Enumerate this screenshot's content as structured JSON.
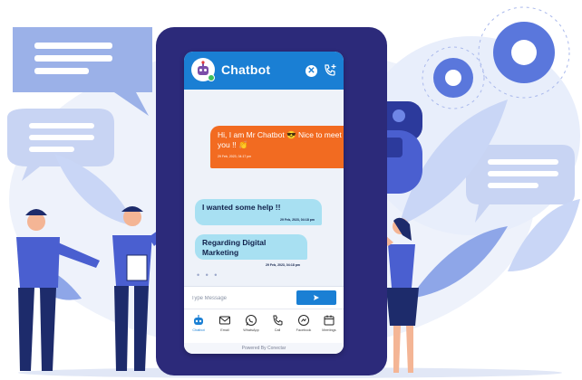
{
  "header": {
    "title": "Chatbot",
    "close_icon": "close-icon",
    "call_icon": "phone-plus-icon"
  },
  "messages": [
    {
      "from": "bot",
      "text": "Hi, I am Mr Chatbot 😎 Nice to meet you !! 👏",
      "time": "29 Feb, 2023, 04:17 pm"
    },
    {
      "from": "user",
      "text": "I wanted some help !!",
      "time": "29 Feb, 2023, 04:18 pm"
    },
    {
      "from": "user",
      "text": "Regarding Digital Marketing",
      "time": "29 Feb, 2023, 04:18 pm"
    }
  ],
  "typing_indicator": "• • •",
  "composer": {
    "placeholder": "Type Message",
    "send_icon": "send-icon"
  },
  "nav": [
    {
      "label": "Chatbot",
      "icon": "robot-icon"
    },
    {
      "label": "Email",
      "icon": "email-icon"
    },
    {
      "label": "WhatsApp",
      "icon": "whatsapp-icon"
    },
    {
      "label": "Call",
      "icon": "phone-icon"
    },
    {
      "label": "Facebook",
      "icon": "facebook-icon"
    },
    {
      "label": "Meetings",
      "icon": "calendar-icon"
    }
  ],
  "footer": "Powered By Conectar",
  "colors": {
    "brand_blue": "#1a7fd4",
    "bot_bubble": "#f26b21",
    "user_bubble": "#a8e0f2",
    "phone_frame": "#2c2a7a",
    "illustration_light": "#dfe6f7"
  }
}
